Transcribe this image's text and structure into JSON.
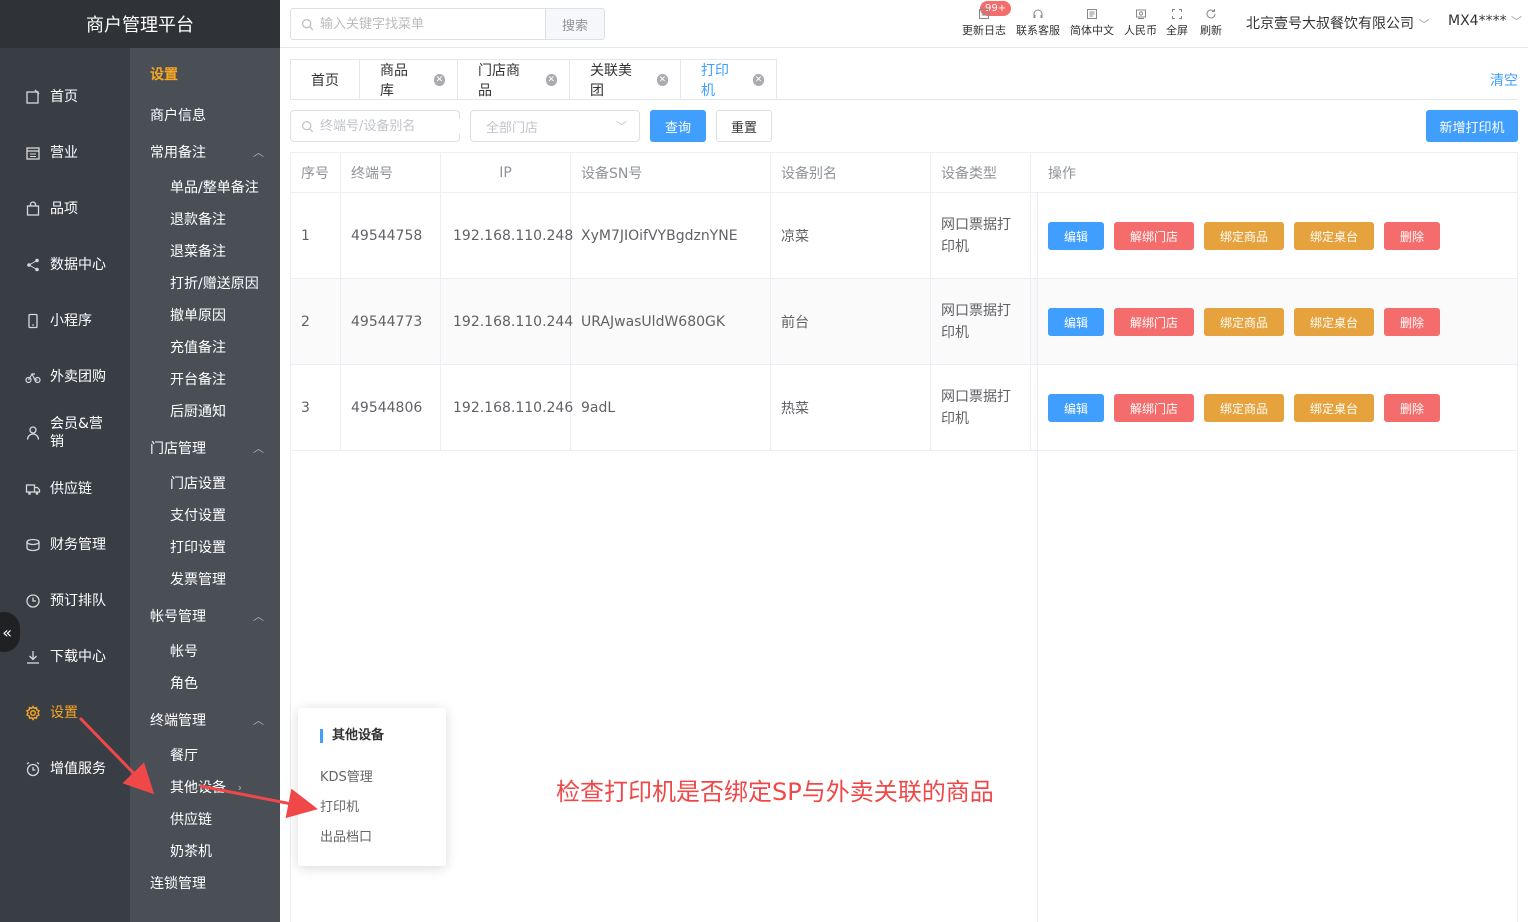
{
  "brand": "商户管理平台",
  "nav1": [
    {
      "label": "首页",
      "icon": "home-icon"
    },
    {
      "label": "营业",
      "icon": "calendar-icon"
    },
    {
      "label": "品项",
      "icon": "bag-icon"
    },
    {
      "label": "数据中心",
      "icon": "share-icon"
    },
    {
      "label": "小程序",
      "icon": "phone-icon"
    },
    {
      "label": "外卖团购",
      "icon": "bike-icon"
    },
    {
      "label": "会员&营销",
      "icon": "user-icon"
    },
    {
      "label": "供应链",
      "icon": "truck-icon"
    },
    {
      "label": "财务管理",
      "icon": "coin-icon"
    },
    {
      "label": "预订排队",
      "icon": "clock-icon"
    },
    {
      "label": "下载中心",
      "icon": "download-icon"
    },
    {
      "label": "设置",
      "icon": "gear-icon"
    },
    {
      "label": "增值服务",
      "icon": "alarm-icon"
    }
  ],
  "nav2": {
    "title": "设置",
    "items": [
      {
        "label": "商户信息",
        "kind": "grp"
      },
      {
        "label": "常用备注",
        "kind": "grp",
        "expanded": true
      },
      {
        "label": "单品/整单备注",
        "kind": "sub"
      },
      {
        "label": "退款备注",
        "kind": "sub"
      },
      {
        "label": "退菜备注",
        "kind": "sub"
      },
      {
        "label": "打折/赠送原因",
        "kind": "sub"
      },
      {
        "label": "撤单原因",
        "kind": "sub"
      },
      {
        "label": "充值备注",
        "kind": "sub"
      },
      {
        "label": "开台备注",
        "kind": "sub"
      },
      {
        "label": "后厨通知",
        "kind": "sub"
      },
      {
        "label": "门店管理",
        "kind": "grp",
        "expanded": true
      },
      {
        "label": "门店设置",
        "kind": "sub"
      },
      {
        "label": "支付设置",
        "kind": "sub"
      },
      {
        "label": "打印设置",
        "kind": "sub"
      },
      {
        "label": "发票管理",
        "kind": "sub"
      },
      {
        "label": "帐号管理",
        "kind": "grp",
        "expanded": true
      },
      {
        "label": "帐号",
        "kind": "sub"
      },
      {
        "label": "角色",
        "kind": "sub"
      },
      {
        "label": "终端管理",
        "kind": "grp",
        "expanded": true
      },
      {
        "label": "餐厅",
        "kind": "sub"
      },
      {
        "label": "其他设备",
        "kind": "sub",
        "hasChildren": true
      },
      {
        "label": "供应链",
        "kind": "sub"
      },
      {
        "label": "奶茶机",
        "kind": "sub"
      },
      {
        "label": "连锁管理",
        "kind": "grp"
      }
    ]
  },
  "header": {
    "search_placeholder": "输入关键字找菜单",
    "search_button": "搜索",
    "badge": "99+",
    "tools": [
      {
        "label": "更新日志",
        "icon": "log-icon"
      },
      {
        "label": "联系客服",
        "icon": "headset-icon"
      },
      {
        "label": "简体中文",
        "icon": "language-icon"
      },
      {
        "label": "人民币",
        "icon": "currency-icon"
      },
      {
        "label": "全屏",
        "icon": "fullscreen-icon"
      },
      {
        "label": "刷新",
        "icon": "refresh-icon"
      }
    ],
    "company": "北京壹号大叔餐饮有限公司",
    "user": "MX4****"
  },
  "tabs": [
    {
      "label": "首页",
      "closable": false
    },
    {
      "label": "商品库",
      "closable": true
    },
    {
      "label": "门店商品",
      "closable": true
    },
    {
      "label": "关联美团",
      "closable": true
    },
    {
      "label": "打印机",
      "closable": true,
      "active": true
    }
  ],
  "clear_label": "清空",
  "filter": {
    "term_placeholder": "终端号/设备别名",
    "store_placeholder": "全部门店",
    "query": "查询",
    "reset": "重置",
    "add": "新增打印机"
  },
  "table": {
    "columns": [
      "序号",
      "终端号",
      "IP",
      "设备SN号",
      "设备别名",
      "设备类型",
      "操作"
    ],
    "rows": [
      {
        "no": "1",
        "terminal": "49544758",
        "ip": "192.168.110.248",
        "sn": "XyM7JIOifVYBgdznYNE",
        "alias": "凉菜",
        "type": "网口票据打印机"
      },
      {
        "no": "2",
        "terminal": "49544773",
        "ip": "192.168.110.244",
        "sn": "URAJwasUldW680GK",
        "alias": "前台",
        "type": "网口票据打印机"
      },
      {
        "no": "3",
        "terminal": "49544806",
        "ip": "192.168.110.246",
        "sn": "9adL",
        "alias": "热菜",
        "type": "网口票据打印机"
      }
    ],
    "actions": [
      "编辑",
      "解绑门店",
      "绑定商品",
      "绑定桌台",
      "删除"
    ]
  },
  "popup": {
    "title": "其他设备",
    "items": [
      "KDS管理",
      "打印机",
      "出品档口"
    ]
  },
  "annotation": "检查打印机是否绑定SP与外卖关联的商品",
  "colors": {
    "accent": "#409eff",
    "danger": "#f56c6c",
    "warning": "#e6a23c",
    "active_nav": "#f5a623",
    "annotation": "#f04848"
  }
}
